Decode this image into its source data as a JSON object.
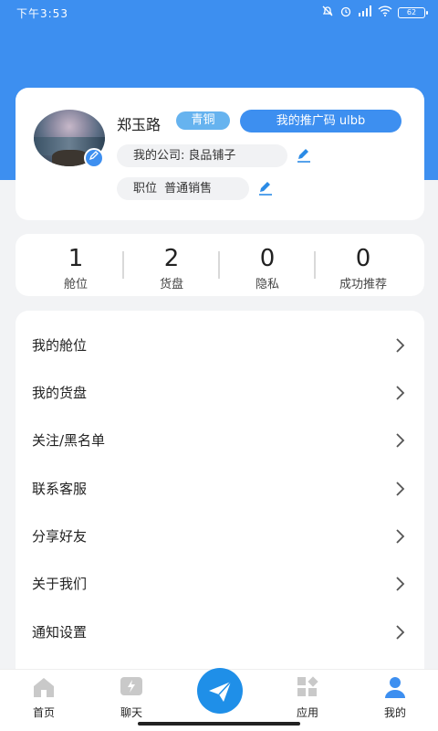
{
  "status_bar": {
    "time": "下午3:53",
    "battery": "62"
  },
  "profile": {
    "name": "郑玉路",
    "level": "青铜",
    "referral_code": "我的推广码 ulbb",
    "company_label": "我的公司:",
    "company_value": "良品铺子",
    "position_label": "职位",
    "position_value": "普通销售"
  },
  "stats": [
    {
      "value": "1",
      "label": "舱位"
    },
    {
      "value": "2",
      "label": "货盘"
    },
    {
      "value": "0",
      "label": "隐私"
    },
    {
      "value": "0",
      "label": "成功推荐"
    }
  ],
  "menu": [
    {
      "label": "我的舱位"
    },
    {
      "label": "我的货盘"
    },
    {
      "label": "关注/黑名单"
    },
    {
      "label": "联系客服"
    },
    {
      "label": "分享好友"
    },
    {
      "label": "关于我们"
    },
    {
      "label": "通知设置"
    }
  ],
  "tabs": [
    {
      "label": "首页",
      "icon": "home-icon"
    },
    {
      "label": "聊天",
      "icon": "chat-icon"
    },
    {
      "label": "",
      "icon": "send-icon"
    },
    {
      "label": "应用",
      "icon": "apps-icon"
    },
    {
      "label": "我的",
      "icon": "user-icon"
    }
  ],
  "colors": {
    "primary": "#3d8ff0",
    "level_badge": "#66b3ef",
    "background": "#f2f3f5"
  }
}
